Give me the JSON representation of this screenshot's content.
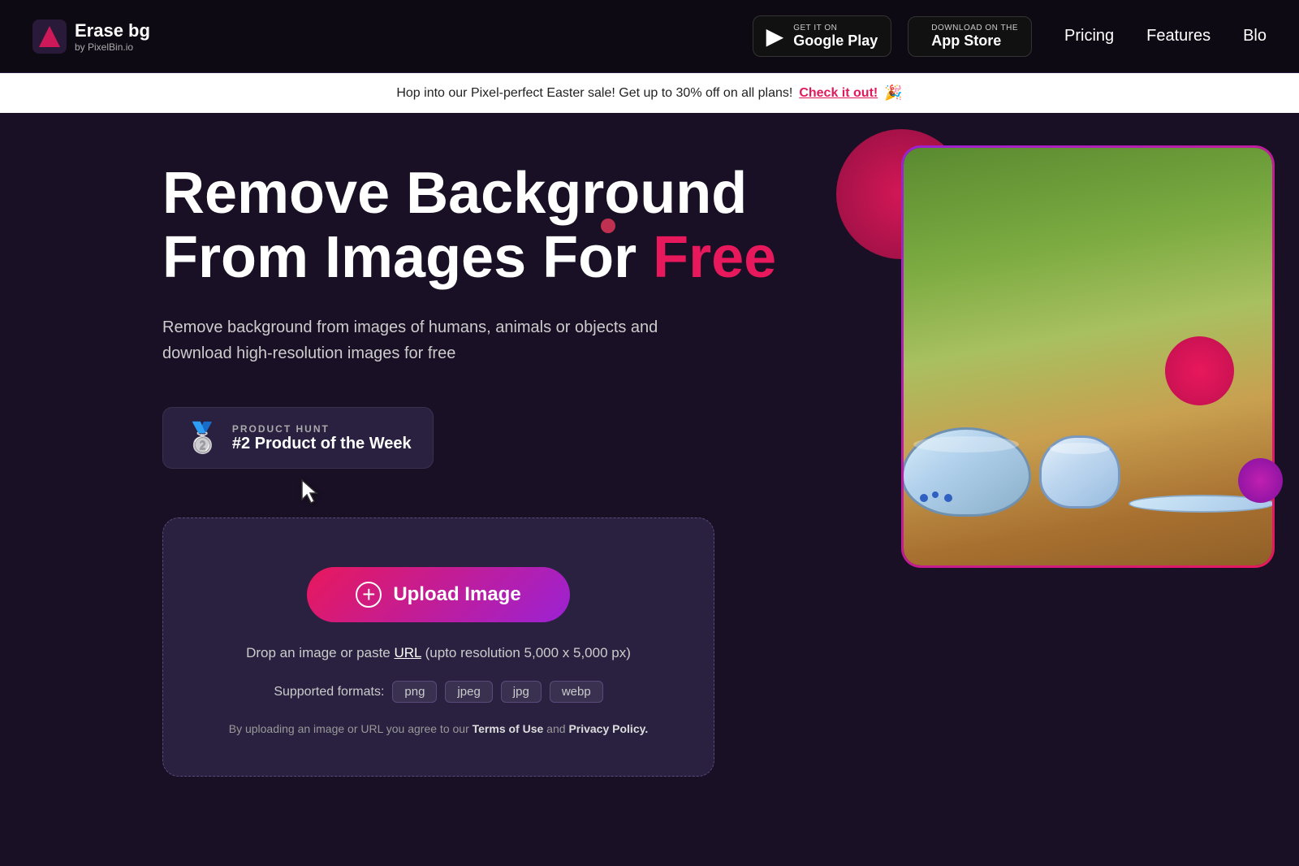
{
  "navbar": {
    "logo_title": "Erase bg",
    "logo_subtitle": "by PixelBin.io",
    "google_play": {
      "small_text": "GET IT ON",
      "big_text": "Google Play"
    },
    "app_store": {
      "small_text": "Download on the",
      "big_text": "App Store"
    },
    "links": [
      "Pricing",
      "Features",
      "Blo"
    ]
  },
  "promo": {
    "text": "Hop into our Pixel-perfect Easter sale! Get up to 30% off on all plans!",
    "cta": "Check it out!",
    "emoji": "🎉"
  },
  "hero": {
    "title_line1": "Remove Background",
    "title_line2": "From Images For ",
    "title_free": "Free",
    "description": "Remove background from images of humans, animals or objects and\ndownload high-resolution images for free",
    "product_hunt": {
      "label": "PRODUCT HUNT",
      "rank": "#2 Product of the Week"
    },
    "upload": {
      "button_label": "Upload Image",
      "drop_text_before": "Drop an image or paste ",
      "drop_url_label": "URL",
      "drop_text_after": " (upto resolution 5,000 x 5,000 px)",
      "formats_label": "Supported formats:",
      "formats": [
        "png",
        "jpeg",
        "jpg",
        "webp"
      ],
      "terms_text_before": "By uploading an image or URL you agree to our ",
      "terms_label": "Terms of Use",
      "terms_and": " and ",
      "privacy_label": "Privacy Policy."
    }
  }
}
